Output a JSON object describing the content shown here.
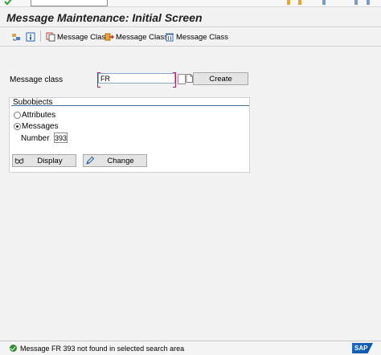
{
  "title": "Message Maintenance: Initial Screen",
  "toolbar": {
    "items": [
      {
        "label": ""
      },
      {
        "label": ""
      },
      {
        "label": "Message Class"
      },
      {
        "label": "Message Class"
      },
      {
        "label": "Message Class"
      }
    ]
  },
  "message_class": {
    "label": "Message class",
    "value": "FR",
    "create_label": "Create"
  },
  "subobjects": {
    "title": "Subobjects",
    "attributes_label": "Attributes",
    "messages_label": "Messages",
    "selected": "Messages",
    "number_label": "Number",
    "number_value": "393",
    "display_label": "Display",
    "change_label": "Change"
  },
  "status": {
    "text": "Message FR 393 not found in selected search area",
    "type": "success"
  },
  "brand": {
    "logo_text": "SAP",
    "accent": "#4a6fa5"
  }
}
